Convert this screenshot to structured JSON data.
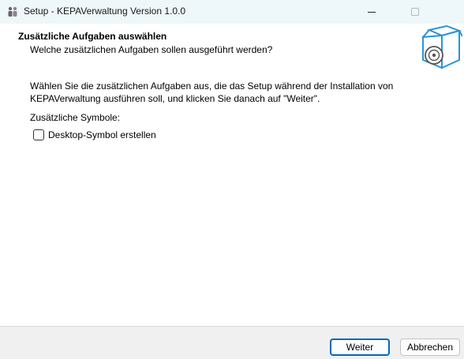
{
  "window": {
    "title": "Setup - KEPAVerwaltung Version 1.0.0",
    "icons": {
      "app": "setup-app-icon",
      "minimize": "minimize-icon",
      "maximize": "maximize-icon"
    }
  },
  "header": {
    "heading": "Zusätzliche Aufgaben auswählen",
    "subheading": "Welche zusätzlichen Aufgaben sollen ausgeführt werden?",
    "image": "setup-box-cd-icon"
  },
  "main": {
    "description": "Wählen Sie die zusätzlichen Aufgaben aus, die das Setup während der Installation von KEPAVerwaltung ausführen soll, und klicken Sie danach auf \"Weiter\".",
    "group_label": "Zusätzliche Symbole:",
    "tasks": [
      {
        "label": "Desktop-Symbol erstellen",
        "checked": false
      }
    ]
  },
  "footer": {
    "next_label": "Weiter",
    "cancel_label": "Abbrechen"
  },
  "colors": {
    "titlebar": "#eef7f9",
    "footer": "#f0f0f0",
    "accent": "#0067c0",
    "box_blue": "#2b93d6"
  }
}
